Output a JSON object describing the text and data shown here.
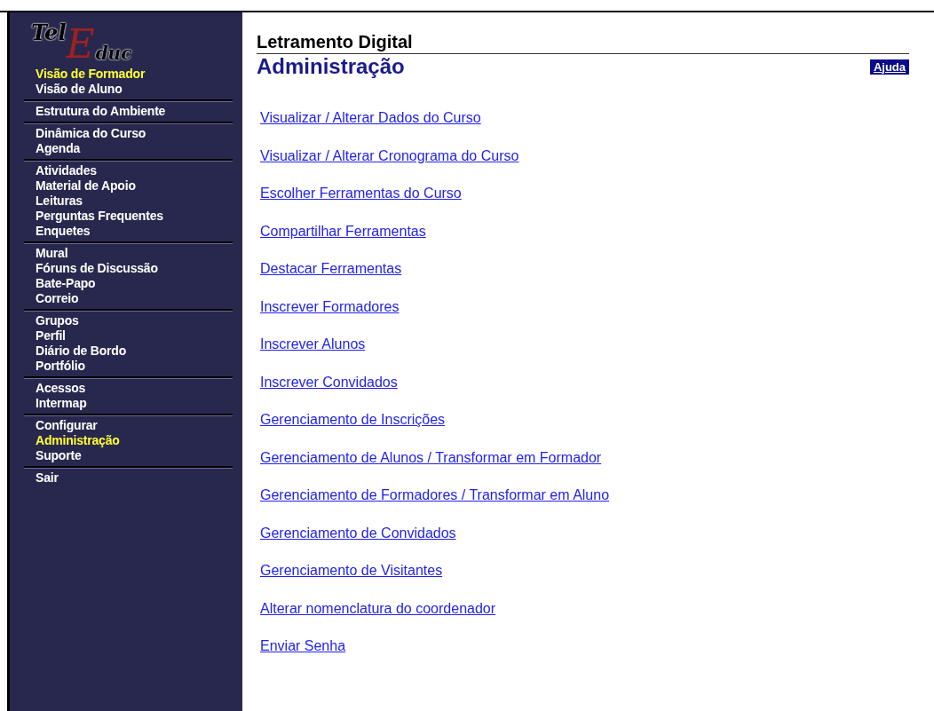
{
  "logo": {
    "parts": [
      "Tel",
      "E",
      "duc"
    ]
  },
  "sidebar": {
    "groups": [
      {
        "items": [
          {
            "label": "Visão de Formador",
            "selected": true
          },
          {
            "label": "Visão de Aluno",
            "selected": false
          }
        ]
      },
      {
        "items": [
          {
            "label": "Estrutura do Ambiente",
            "selected": false
          }
        ]
      },
      {
        "items": [
          {
            "label": "Dinâmica do Curso",
            "selected": false
          },
          {
            "label": "Agenda",
            "selected": false
          }
        ]
      },
      {
        "items": [
          {
            "label": "Atividades",
            "selected": false
          },
          {
            "label": "Material de Apoio",
            "selected": false
          },
          {
            "label": "Leituras",
            "selected": false
          },
          {
            "label": "Perguntas Frequentes",
            "selected": false
          },
          {
            "label": "Enquetes",
            "selected": false
          }
        ]
      },
      {
        "items": [
          {
            "label": "Mural",
            "selected": false
          },
          {
            "label": "Fóruns de Discussão",
            "selected": false
          },
          {
            "label": "Bate-Papo",
            "selected": false
          },
          {
            "label": "Correio",
            "selected": false
          }
        ]
      },
      {
        "items": [
          {
            "label": "Grupos",
            "selected": false
          },
          {
            "label": "Perfil",
            "selected": false
          },
          {
            "label": "Diário de Bordo",
            "selected": false
          },
          {
            "label": "Portfólio",
            "selected": false
          }
        ]
      },
      {
        "items": [
          {
            "label": "Acessos",
            "selected": false
          },
          {
            "label": "Intermap",
            "selected": false
          }
        ]
      },
      {
        "items": [
          {
            "label": "Configurar",
            "selected": false
          },
          {
            "label": "Administração",
            "selected": true
          },
          {
            "label": "Suporte",
            "selected": false
          }
        ]
      },
      {
        "items": [
          {
            "label": "Sair",
            "selected": false
          }
        ]
      }
    ]
  },
  "course_title": "Letramento Digital",
  "page_title": "Administração",
  "help_button": "Ajuda",
  "links": [
    "Visualizar / Alterar Dados do Curso",
    "Visualizar / Alterar Cronograma do Curso",
    "Escolher Ferramentas do Curso",
    "Compartilhar Ferramentas",
    "Destacar Ferramentas",
    "Inscrever Formadores",
    "Inscrever Alunos",
    "Inscrever Convidados",
    "Gerenciamento de Inscrições",
    "Gerenciamento de Alunos / Transformar em Formador",
    "Gerenciamento de Formadores / Transformar em Aluno",
    "Gerenciamento de Convidados",
    "Gerenciamento de Visitantes",
    "Alterar nomenclatura do coordenador",
    "Enviar Senha"
  ]
}
